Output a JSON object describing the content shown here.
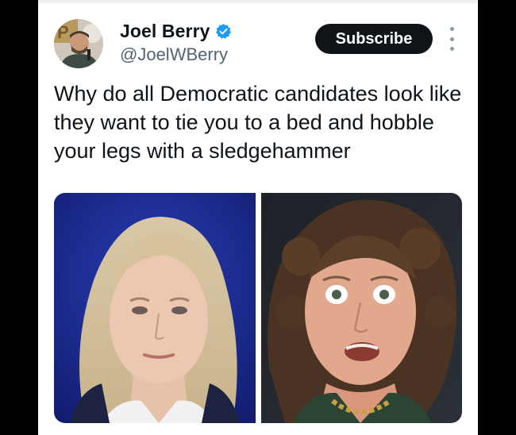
{
  "tweet": {
    "author": {
      "display_name": "Joel Berry",
      "handle": "@JoelWBerry",
      "verified": true,
      "avatar_badge_text": "P"
    },
    "subscribe_label": "Subscribe",
    "text": "Why do all Democratic candidates look like they want to tie you to a bed and hobble your legs with a sledgehammer",
    "media": [
      {
        "description_name": "photo-left"
      },
      {
        "description_name": "photo-right"
      }
    ]
  },
  "colors": {
    "verified_blue": "#1d9bf0",
    "button_bg": "#0f1419",
    "handle_gray": "#536471"
  },
  "icons": [
    "verified-badge-icon",
    "more-options-icon"
  ]
}
